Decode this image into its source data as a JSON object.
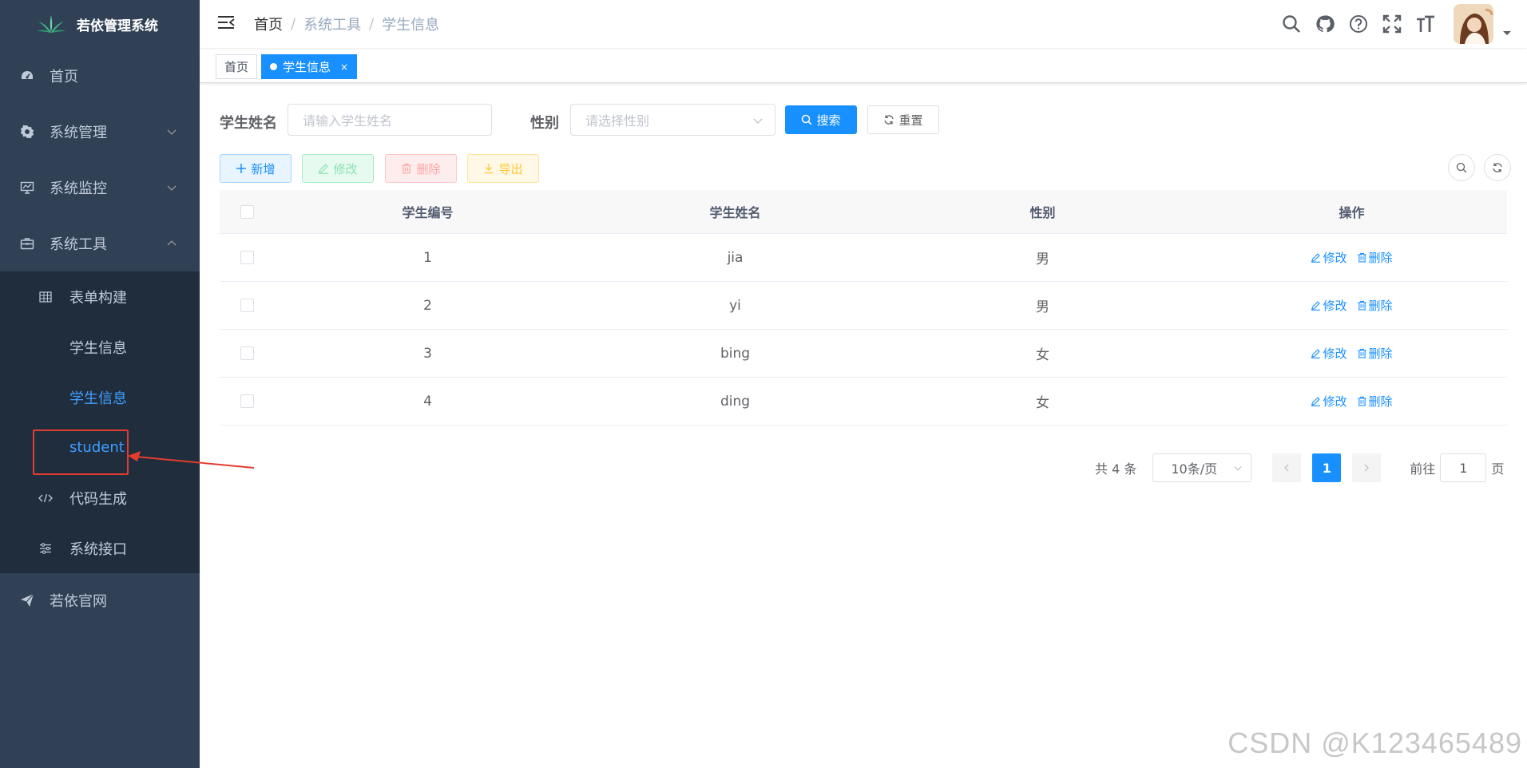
{
  "app": {
    "title": "若依管理系统"
  },
  "sidebar": {
    "items": [
      {
        "label": "首页",
        "icon": "dashboard-icon"
      },
      {
        "label": "系统管理",
        "icon": "gear-icon"
      },
      {
        "label": "系统监控",
        "icon": "monitor-icon"
      },
      {
        "label": "系统工具",
        "icon": "toolbox-icon"
      }
    ],
    "sub_items": [
      {
        "label": "表单构建",
        "icon": "table-icon"
      },
      {
        "label": "学生信息"
      },
      {
        "label": "学生信息"
      },
      {
        "label": "student"
      },
      {
        "label": "代码生成",
        "icon": "code-icon"
      },
      {
        "label": "系统接口",
        "icon": "sliders-icon"
      }
    ],
    "footer_item": {
      "label": "若依官网",
      "icon": "send-icon"
    }
  },
  "header": {
    "breadcrumb": [
      "首页",
      "系统工具",
      "学生信息"
    ],
    "breadcrumb_sep": "/"
  },
  "tags": {
    "home": "首页",
    "active": "学生信息",
    "close": "×"
  },
  "search": {
    "name_label": "学生姓名",
    "name_placeholder": "请输入学生姓名",
    "sex_label": "性别",
    "sex_placeholder": "请选择性别",
    "search_btn": "搜索",
    "reset_btn": "重置"
  },
  "toolbar": {
    "add": "新增",
    "edit": "修改",
    "delete": "删除",
    "export": "导出"
  },
  "table": {
    "headers": [
      "学生编号",
      "学生姓名",
      "性别",
      "操作"
    ],
    "rows": [
      {
        "id": "1",
        "name": "jia",
        "sex": "男"
      },
      {
        "id": "2",
        "name": "yi",
        "sex": "男"
      },
      {
        "id": "3",
        "name": "bing",
        "sex": "女"
      },
      {
        "id": "4",
        "name": "ding",
        "sex": "女"
      }
    ],
    "edit_link": "修改",
    "delete_link": "删除"
  },
  "pagination": {
    "total": "共 4 条",
    "page_size": "10条/页",
    "current": "1",
    "goto_prefix": "前往",
    "goto_value": "1",
    "goto_suffix": "页"
  },
  "colors": {
    "sidebar_bg": "#304156",
    "submenu_bg": "#1f2d3d",
    "primary": "#1890ff",
    "highlight": "#e43c2f"
  },
  "watermark": "CSDN @K123465489"
}
